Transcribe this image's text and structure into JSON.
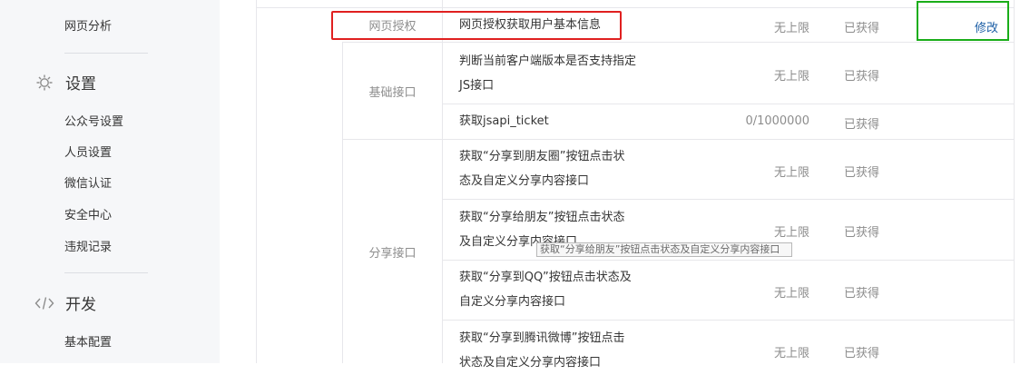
{
  "sidebar": {
    "top_item": "网页分析",
    "settings": {
      "icon": "gear-icon",
      "label": "设置",
      "items": [
        "公众号设置",
        "人员设置",
        "微信认证",
        "安全中心",
        "违规记录"
      ]
    },
    "develop": {
      "icon": "code-icon",
      "label": "开发",
      "items": [
        "基本配置"
      ]
    }
  },
  "table": {
    "rows": [
      {
        "category": "网页授权",
        "interface": "网页授权获取用户基本信息",
        "limit": "无上限",
        "status": "已获得",
        "action": "修改"
      },
      {
        "category": "基础接口",
        "interface": "判断当前客户端版本是否支持指定JS接口",
        "limit": "无上限",
        "status": "已获得"
      },
      {
        "interface": "获取jsapi_ticket",
        "limit": "0/1000000",
        "status": "已获得"
      },
      {
        "category": "分享接口",
        "interface": "获取“分享到朋友圈”按钮点击状态及自定义分享内容接口",
        "limit": "无上限",
        "status": "已获得"
      },
      {
        "interface": "获取“分享给朋友”按钮点击状态及自定义分享内容接口",
        "limit": "无上限",
        "status": "已获得"
      },
      {
        "interface": "获取“分享到QQ”按钮点击状态及自定义分享内容接口",
        "limit": "无上限",
        "status": "已获得"
      },
      {
        "interface": "获取“分享到腾讯微博”按钮点击状态及自定义分享内容接口",
        "limit": "无上限",
        "status": "已获得"
      }
    ],
    "tooltip": "获取“分享给朋友”按钮点击状态及自定义分享内容接口"
  },
  "colors": {
    "highlight_red": "#e02020",
    "highlight_green": "#1aad19",
    "link_blue": "#1d5fa6"
  }
}
